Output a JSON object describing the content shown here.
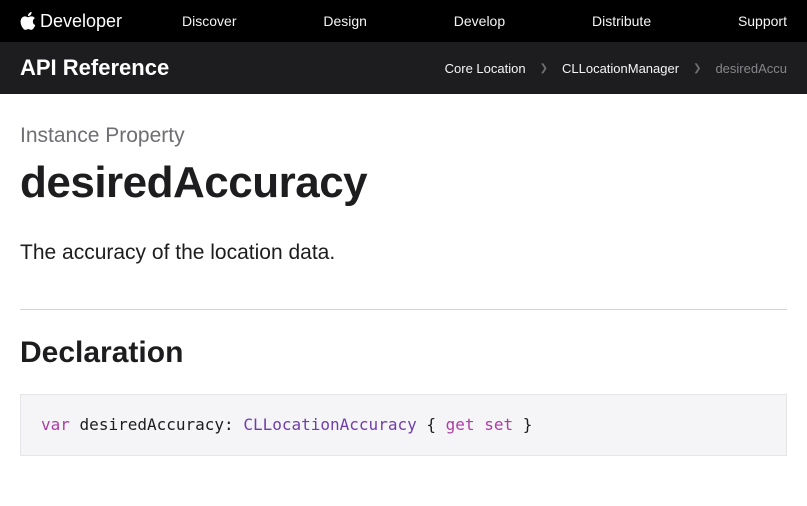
{
  "topnav": {
    "logo_text": "Developer",
    "links": [
      "Discover",
      "Design",
      "Develop",
      "Distribute",
      "Support"
    ]
  },
  "subnav": {
    "title": "API Reference",
    "breadcrumb": [
      {
        "label": "Core Location",
        "current": false
      },
      {
        "label": "CLLocationManager",
        "current": false
      },
      {
        "label": "desiredAccu",
        "current": true
      }
    ]
  },
  "page": {
    "eyebrow": "Instance Property",
    "title": "desiredAccuracy",
    "summary": "The accuracy of the location data.",
    "declaration_heading": "Declaration",
    "declaration": {
      "var_kw": "var",
      "identifier": "desiredAccuracy",
      "colon": ":",
      "type": "CLLocationAccuracy",
      "open_brace": "{",
      "get_kw": "get",
      "set_kw": "set",
      "close_brace": "}"
    }
  }
}
